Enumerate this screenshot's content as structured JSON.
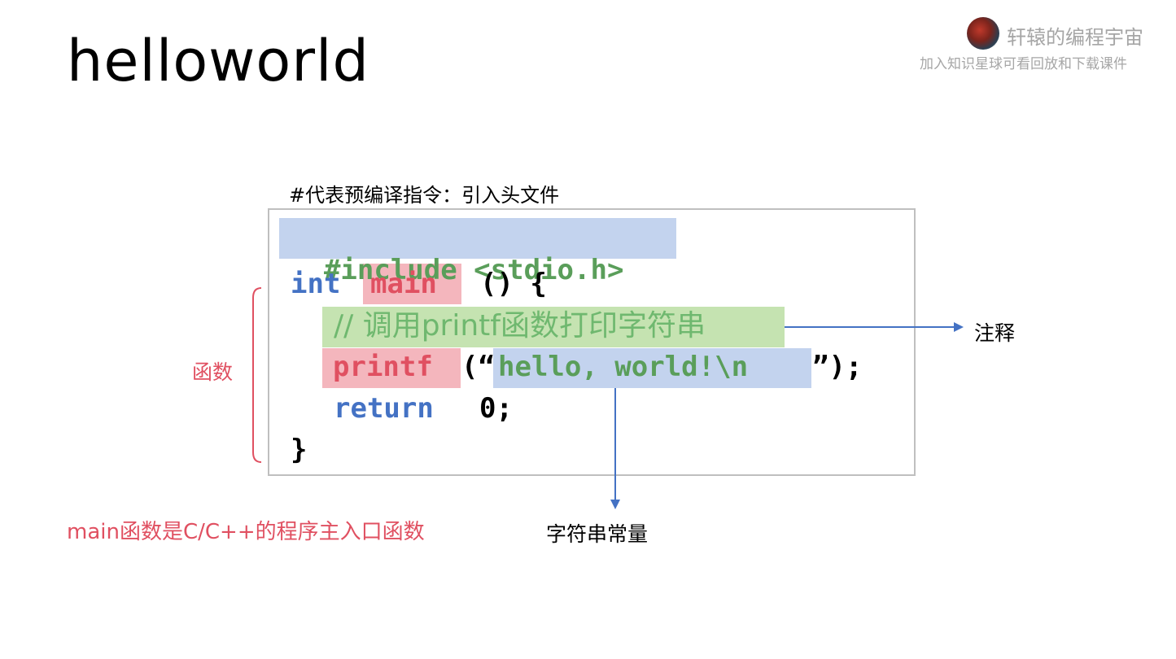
{
  "slide": {
    "title": "helloworld",
    "brand_name": "轩辕的编程宇宙",
    "brand_sub": "加入知识星球可看回放和下载课件"
  },
  "notes": {
    "preprocessor": "#代表预编译指令：引入头文件",
    "comment_label": "注释",
    "function_label": "函数",
    "string_label": "字符串常量",
    "main_note": "main函数是C/C++的程序主入口函数"
  },
  "code": {
    "include": "#include <stdio.h>",
    "int_kw": "int",
    "main_kw": "main",
    "main_rest": "() {",
    "comment": "// 调用printf函数打印字符串",
    "printf_kw": "printf",
    "open_paren": "(“",
    "string_body": "hello, world!\\n",
    "close": "”);",
    "return_kw": "return",
    "return_rest": "0;",
    "closing_brace": "}"
  },
  "colors": {
    "keyword": "#4472c4",
    "function": "#e05061",
    "comment": "#6fb86f",
    "string": "#5a9e5a",
    "highlight_blue": "#c3d3ee",
    "highlight_red": "#f4b6bd",
    "highlight_green": "#c5e3b1"
  }
}
